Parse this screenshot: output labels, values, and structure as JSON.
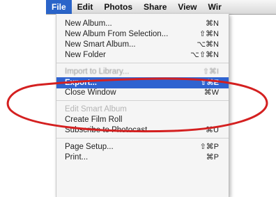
{
  "menubar": {
    "items": [
      "File",
      "Edit",
      "Photos",
      "Share",
      "View",
      "Wir"
    ],
    "active_index": 0
  },
  "file_menu": {
    "groups": [
      [
        {
          "label": "New Album...",
          "shortcut": "⌘N",
          "enabled": true
        },
        {
          "label": "New Album From Selection...",
          "shortcut": "⇧⌘N",
          "enabled": true
        },
        {
          "label": "New Smart Album...",
          "shortcut": "⌥⌘N",
          "enabled": true
        },
        {
          "label": "New Folder",
          "shortcut": "⌥⇧⌘N",
          "enabled": true
        }
      ],
      [
        {
          "label": "Import to Library...",
          "shortcut": "⇧⌘I",
          "enabled": true,
          "faded": true
        },
        {
          "label": "Export...",
          "shortcut": "⇧⌘E",
          "enabled": true,
          "selected": true
        },
        {
          "label": "Close Window",
          "shortcut": "⌘W",
          "enabled": true
        }
      ],
      [
        {
          "label": "Edit Smart Album",
          "shortcut": "",
          "enabled": false
        },
        {
          "label": "Create Film Roll",
          "shortcut": "",
          "enabled": true
        },
        {
          "label": "Subscribe to Photocast...",
          "shortcut": "⌘U",
          "enabled": true
        }
      ],
      [
        {
          "label": "Page Setup...",
          "shortcut": "⇧⌘P",
          "enabled": true
        },
        {
          "label": "Print...",
          "shortcut": "⌘P",
          "enabled": true
        }
      ]
    ]
  },
  "annotation": {
    "highlight_color": "#d42020",
    "selected_color": "#2f63d0"
  }
}
